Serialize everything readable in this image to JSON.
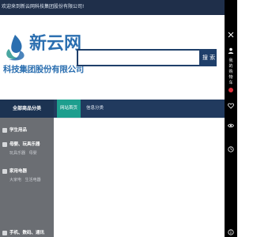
{
  "topbar": {
    "welcome": "欢迎来到新云网科技集团股份有限公司!"
  },
  "header": {
    "logo_name": "新云网",
    "logo_company": "科技集团股份有限公司",
    "search_placeholder": "",
    "search_button": "搜 索"
  },
  "nav": {
    "all_categories": "全部商品分类",
    "tabs": [
      {
        "label": "网站首页",
        "active": true
      },
      {
        "label": "信息分类",
        "active": false
      }
    ]
  },
  "sidebar": {
    "categories": [
      {
        "title": "学生用品",
        "subs": []
      },
      {
        "title": "母婴、玩具乐器",
        "subs": [
          "玩具乐器",
          "母婴"
        ]
      },
      {
        "title": "家用电器",
        "subs": [
          "大家电",
          "生活电器"
        ]
      },
      {
        "title": "手机、数码、通讯",
        "subs": []
      }
    ]
  },
  "right_bar": {
    "items": [
      {
        "icon": "close-x-icon",
        "label": ""
      },
      {
        "icon": "person-icon",
        "label": ""
      },
      {
        "icon": "",
        "label": "我"
      },
      {
        "icon": "",
        "label": "的"
      },
      {
        "icon": "",
        "label": "购"
      },
      {
        "icon": "",
        "label": "物"
      },
      {
        "icon": "",
        "label": "车"
      },
      {
        "icon": "cart-badge-icon",
        "label": ""
      },
      {
        "icon": "heart-icon",
        "label": ""
      },
      {
        "icon": "eye-icon",
        "label": ""
      },
      {
        "icon": "clock-icon",
        "label": ""
      },
      {
        "icon": "info-icon",
        "label": ""
      }
    ]
  },
  "colors": {
    "topbar": "#1f2f4a",
    "brand_blue": "#2b6fb0",
    "nav": "#213a5e",
    "active_tab": "#1d9e8e",
    "sidebar": "#6b6e73",
    "right_bar": "#000000",
    "badge": "#e0313b"
  }
}
